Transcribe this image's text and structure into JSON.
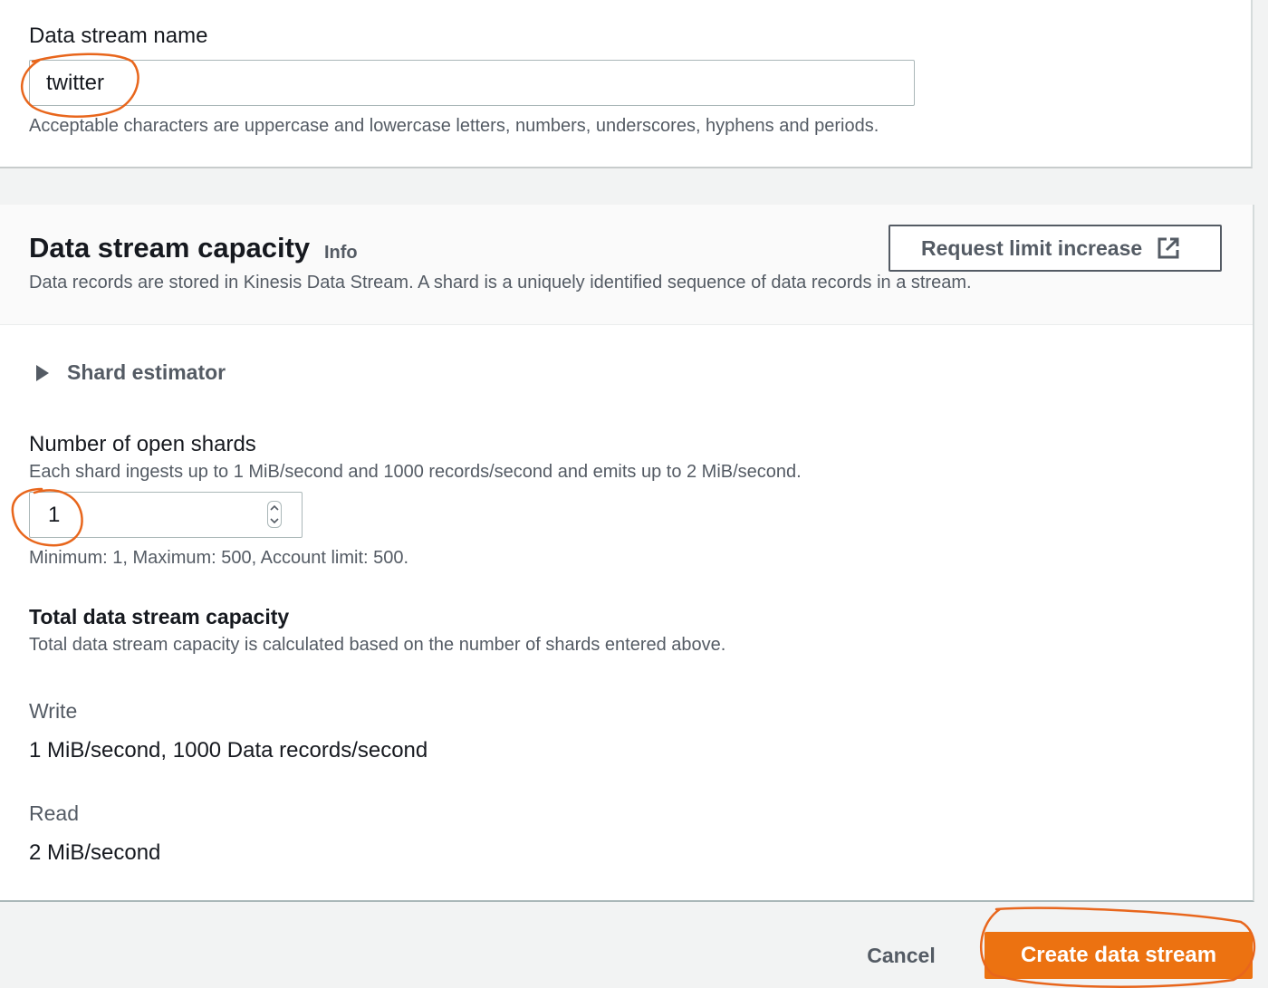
{
  "stream_name": {
    "label": "Data stream name",
    "value": "twitter",
    "hint": "Acceptable characters are uppercase and lowercase letters, numbers, underscores, hyphens and periods."
  },
  "capacity": {
    "title": "Data stream capacity",
    "info_label": "Info",
    "description": "Data records are stored in Kinesis Data Stream. A shard is a uniquely identified sequence of data records in a stream.",
    "request_limit_button": "Request limit increase",
    "shard_estimator_label": "Shard estimator",
    "shards": {
      "label": "Number of open shards",
      "hint": "Each shard ingests up to 1 MiB/second and 1000 records/second and emits up to 2 MiB/second.",
      "value": "1",
      "constraints": "Minimum: 1, Maximum: 500, Account limit: 500."
    },
    "total": {
      "title": "Total data stream capacity",
      "description": "Total data stream capacity is calculated based on the number of shards entered above.",
      "write_label": "Write",
      "write_value": "1 MiB/second, 1000 Data records/second",
      "read_label": "Read",
      "read_value": "2 MiB/second"
    }
  },
  "actions": {
    "cancel_label": "Cancel",
    "create_label": "Create data stream"
  },
  "colors": {
    "primary_button": "#ec7211",
    "annotation": "#e8661c",
    "text_secondary": "#545b64",
    "page_background": "#f2f3f3"
  },
  "icons": {
    "external_link": "external-link-icon",
    "expand_caret": "caret-right-icon",
    "stepper": "stepper-icon"
  }
}
